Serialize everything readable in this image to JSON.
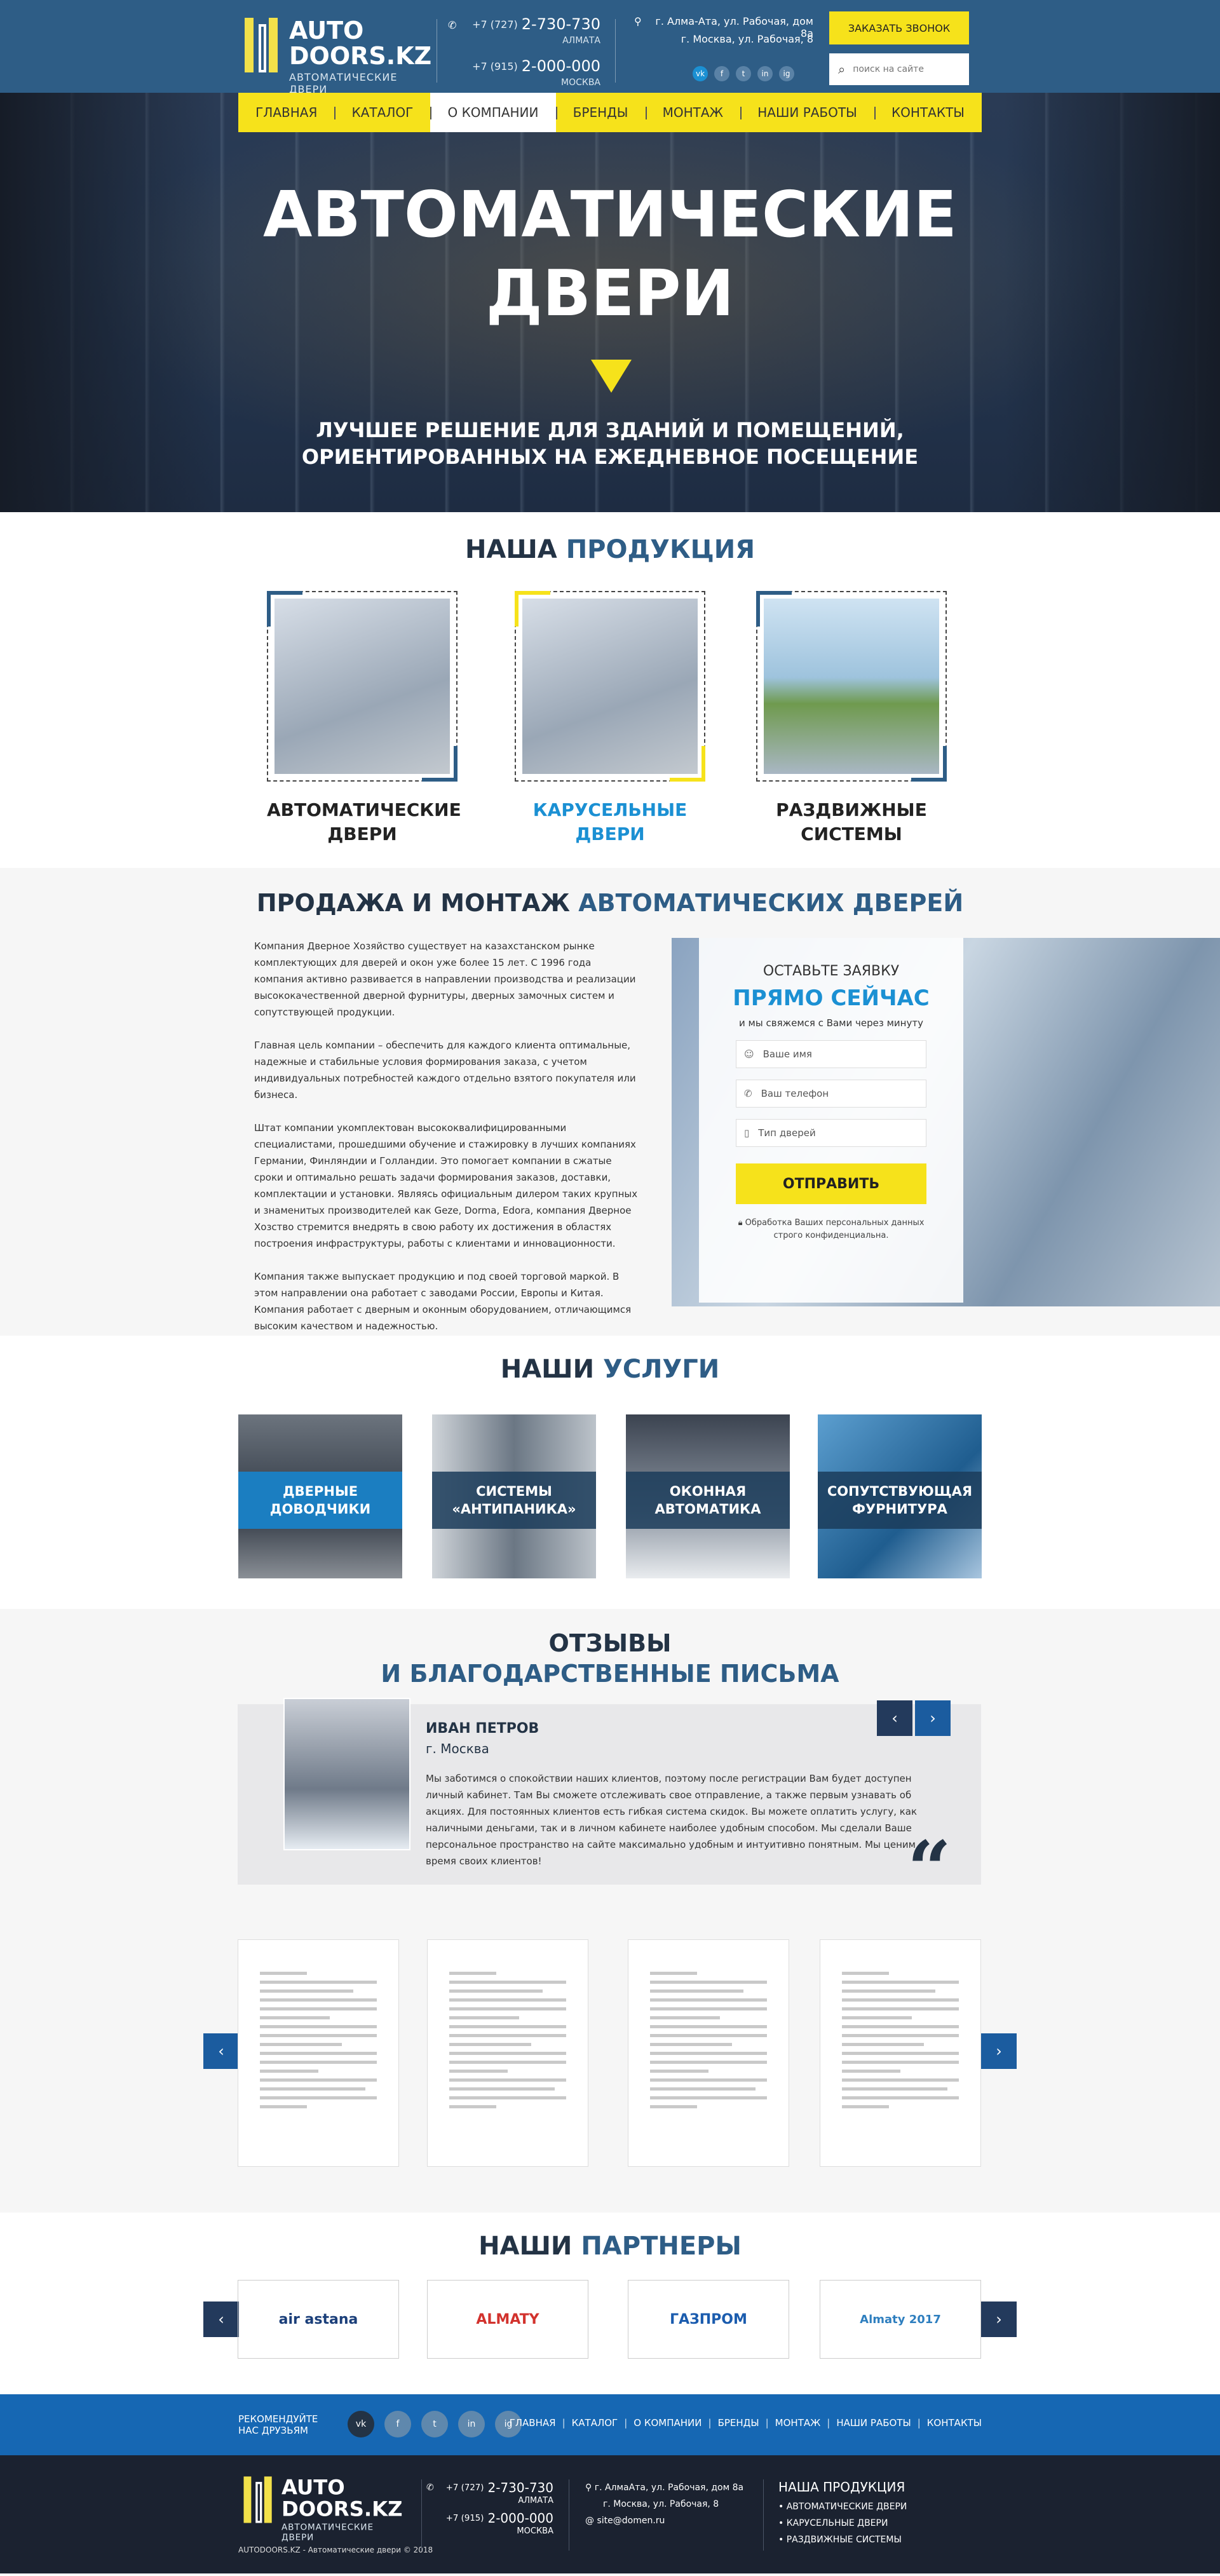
{
  "header": {
    "logo_title_1": "AUTO",
    "logo_title_2": "DOORS.KZ",
    "logo_subtitle": "АВТОМАТИЧЕСКИЕ ДВЕРИ",
    "phones": [
      {
        "code": "+7 (727)",
        "number": "2-730-730",
        "city": "АЛМАТА"
      },
      {
        "code": "+7 (915)",
        "number": "2-000-000",
        "city": "МОСКВА"
      }
    ],
    "address": [
      "г. Алма-Ата, ул. Рабочая, дом 8а",
      "г. Москва, ул. Рабочая, 8"
    ],
    "social": [
      "vk",
      "f",
      "t",
      "in",
      "ig"
    ],
    "call_button": "ЗАКАЗАТЬ ЗВОНОК",
    "search_placeholder": "поиск на сайте"
  },
  "nav": [
    "ГЛАВНАЯ",
    "КАТАЛОГ",
    "О КОМПАНИИ",
    "БРЕНДЫ",
    "МОНТАЖ",
    "НАШИ РАБОТЫ",
    "КОНТАКТЫ"
  ],
  "nav_active": "О КОМПАНИИ",
  "hero": {
    "title_1": "АВТОМАТИЧЕСКИЕ",
    "title_2": "ДВЕРИ",
    "subtitle_1": "ЛУЧШЕЕ РЕШЕНИЕ ДЛЯ ЗДАНИЙ И ПОМЕЩЕНИЙ,",
    "subtitle_2": "ОРИЕНТИРОВАННЫХ НА ЕЖЕДНЕВНОЕ ПОСЕЩЕНИЕ"
  },
  "products": {
    "title_a": "НАША ",
    "title_b": "ПРОДУКЦИЯ",
    "items": [
      {
        "name_1": "АВТОМАТИЧЕСКИЕ",
        "name_2": "ДВЕРИ"
      },
      {
        "name_1": "КАРУСЕЛЬНЫЕ",
        "name_2": "ДВЕРИ"
      },
      {
        "name_1": "РАЗДВИЖНЫЕ",
        "name_2": "СИСТЕМЫ"
      }
    ]
  },
  "sales": {
    "title_a": "ПРОДАЖА И МОНТАЖ ",
    "title_b": "АВТОМАТИЧЕСКИХ ДВЕРЕЙ",
    "paragraphs": [
      "Компания Дверное Хозяйство существует на казахстанском рынке комплектующих для дверей и окон уже более 15 лет. С 1996 года компания активно развивается в направлении производства и реализации высококачественной дверной фурнитуры, дверных замочных систем и сопутствующей продукции.",
      "Главная цель компании – обеспечить для каждого клиента оптимальные, надежные и стабильные условия формирования заказа, с учетом индивидуальных потребностей каждого отдельно взятого покупателя или бизнеса.",
      "Штат компании укомплектован высококвалифицированными специалистами, прошедшими обучение и стажировку в лучших компаниях Германии, Финляндии и Голландии. Это помогает компании в сжатые сроки и оптимально решать задачи формирования заказов, доставки, комплектации и установки. Являясь официальным дилером таких крупных и знаменитых производителей как Geze, Dorma, Edora, компания Дверное Хозство стремится внедрять в свою работу их достижения в областях построения инфраструктуры, работы с клиентами и инновационности.",
      "Компания также выпускает продукцию и под своей торговой маркой. В этом направлении она работает с заводами России, Европы и Китая. Компания работает с дверным и оконным оборудованием, отличающимся высоким качеством и надежностью."
    ],
    "form": {
      "line1": "ОСТАВЬТЕ ЗАЯВКУ",
      "line2": "ПРЯМО СЕЙЧАС",
      "line3": "и мы свяжемся с Вами через минуту",
      "name_ph": "Ваше имя",
      "phone_ph": "Ваш телефон",
      "type_ph": "Тип дверей",
      "submit": "ОТПРАВИТЬ",
      "note": "Обработка Ваших персональных данных строго конфиденциальна."
    }
  },
  "services": {
    "title_a": "НАШИ ",
    "title_b": "УСЛУГИ",
    "items": [
      {
        "l1": "ДВЕРНЫЕ",
        "l2": "ДОВОДЧИКИ"
      },
      {
        "l1": "СИСТЕМЫ",
        "l2": "«АНТИПАНИКА»"
      },
      {
        "l1": "ОКОННАЯ",
        "l2": "АВТОМАТИКА"
      },
      {
        "l1": "СОПУТСТВУЮЩАЯ",
        "l2": "ФУРНИТУРА"
      }
    ]
  },
  "reviews": {
    "title_1": "ОТЗЫВЫ",
    "title_2": "И БЛАГОДАРСТВЕННЫЕ ПИСЬМА",
    "name": "ИВАН ПЕТРОВ",
    "city": "г. Москва",
    "text": "Мы заботимся о спокойствии наших клиентов, поэтому после регистрации Вам будет доступен личный кабинет. Там Вы сможете отслеживать свое отправление, а также первым узнавать об акциях. Для постоянных клиентов есть гибкая система скидок. Вы можете оплатить услугу, как наличными деньгами, так и в личном кабинете наиболее удобным способом. Мы сделали Ваше персональное пространство на сайте максимально удобным и интуитивно понятным. Мы ценим время своих клиентов!"
  },
  "partners": {
    "title_a": "НАШИ ",
    "title_b": "ПАРТНЕРЫ",
    "items": [
      "air astana",
      "ALMATY",
      "ГАЗПРОМ",
      "Almaty 2017"
    ]
  },
  "footer": {
    "recommend_1": "РЕКОМЕНДУЙТЕ",
    "recommend_2": "НАС ДРУЗЬЯМ",
    "social": [
      "vk",
      "f",
      "t",
      "in",
      "ig"
    ],
    "links": [
      "ГЛАВНАЯ",
      "КАТАЛОГ",
      "О КОМПАНИИ",
      "БРЕНДЫ",
      "МОНТАЖ",
      "НАШИ РАБОТЫ",
      "КОНТАКТЫ"
    ],
    "copyright": "AUTODOORS.KZ - Автоматические двери © 2018",
    "address": [
      "г. АлмаАта, ул. Рабочая, дом 8а",
      "г. Москва, ул. Рабочая, 8"
    ],
    "email": "site@domen.ru",
    "products_title": "НАША ПРОДУКЦИЯ",
    "products": [
      "• АВТОМАТИЧЕСКИЕ ДВЕРИ",
      "• КАРУСЕЛЬНЫЕ ДВЕРИ",
      "• РАЗДВИЖНЫЕ СИСТЕМЫ"
    ]
  },
  "colors": {
    "brand_blue": "#2e5d86",
    "accent_yellow": "#f6e21b",
    "link_blue": "#1b90d3",
    "dark": "#1b2230"
  }
}
